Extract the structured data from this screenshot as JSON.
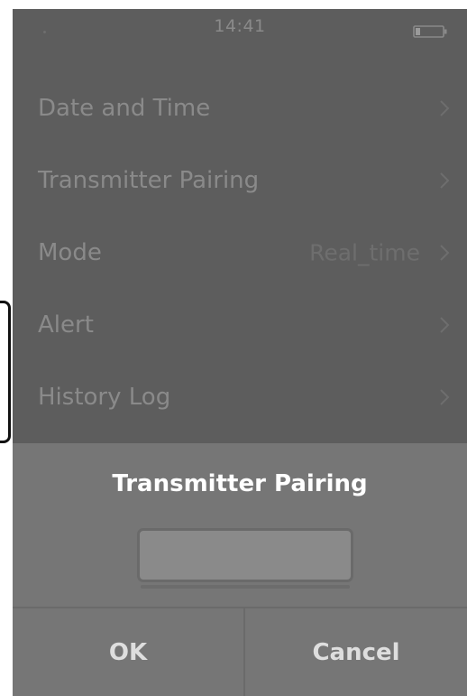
{
  "status_bar": {
    "time": "14:41",
    "battery_icon": "battery-low-icon"
  },
  "menu": {
    "items": [
      {
        "label": "Date and Time",
        "value": "",
        "icon": "chevron-right-icon"
      },
      {
        "label": "Transmitter Pairing",
        "value": "",
        "icon": "chevron-right-icon"
      },
      {
        "label": "Mode",
        "value": "Real_time",
        "icon": "chevron-right-icon"
      },
      {
        "label": "Alert",
        "value": "",
        "icon": "chevron-right-icon"
      },
      {
        "label": "History Log",
        "value": "",
        "icon": "chevron-right-icon"
      }
    ]
  },
  "dialog": {
    "title": "Transmitter Pairing",
    "input_value": "",
    "ok_label": "OK",
    "cancel_label": "Cancel"
  },
  "colors": {
    "screen_background": "#5d5d5d",
    "dialog_background": "#767676",
    "menu_text": "#8a8a8a",
    "dialog_title": "#ffffff"
  }
}
